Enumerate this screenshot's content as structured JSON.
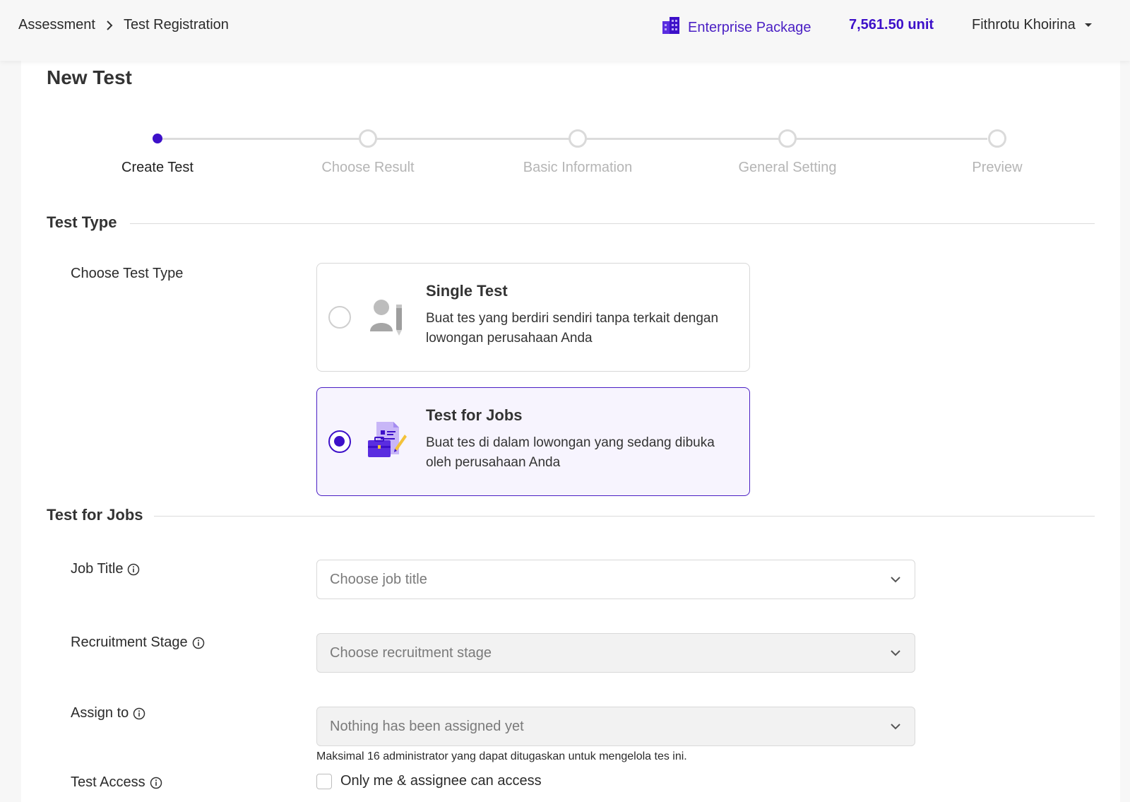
{
  "breadcrumb": {
    "root": "Assessment",
    "current": "Test Registration"
  },
  "header": {
    "package_label": "Enterprise Package",
    "units": "7,561.50 unit",
    "user_name": "Fithrotu Khoirina"
  },
  "page": {
    "title": "New Test"
  },
  "stepper": {
    "steps": [
      {
        "label": "Create Test",
        "active": true
      },
      {
        "label": "Choose Result",
        "active": false
      },
      {
        "label": "Basic Information",
        "active": false
      },
      {
        "label": "General Setting",
        "active": false
      },
      {
        "label": "Preview",
        "active": false
      }
    ]
  },
  "test_type": {
    "section_title": "Test Type",
    "field_label": "Choose Test Type",
    "options": [
      {
        "title": "Single Test",
        "description": "Buat tes yang berdiri sendiri tanpa terkait dengan lowongan perusahaan Anda",
        "selected": false,
        "icon": "person-pencil-icon"
      },
      {
        "title": "Test for Jobs",
        "description": "Buat tes di dalam lowongan yang sedang dibuka oleh perusahaan Anda",
        "selected": true,
        "icon": "briefcase-document-icon"
      }
    ]
  },
  "jobs": {
    "section_title": "Test for Jobs",
    "job_title": {
      "label": "Job Title",
      "placeholder": "Choose job title"
    },
    "recruitment_stage": {
      "label": "Recruitment Stage",
      "placeholder": "Choose recruitment stage"
    },
    "assign_to": {
      "label": "Assign to",
      "placeholder": "Nothing has been assigned yet",
      "hint": "Maksimal 16 administrator yang dapat ditugaskan untuk mengelola tes ini."
    },
    "test_access": {
      "label": "Test Access",
      "checkbox_label": "Only me & assignee can access",
      "checked": false
    }
  },
  "colors": {
    "accent": "#3d10c9",
    "accent_light": "#f7f4fe",
    "border": "#d7d7d7"
  }
}
